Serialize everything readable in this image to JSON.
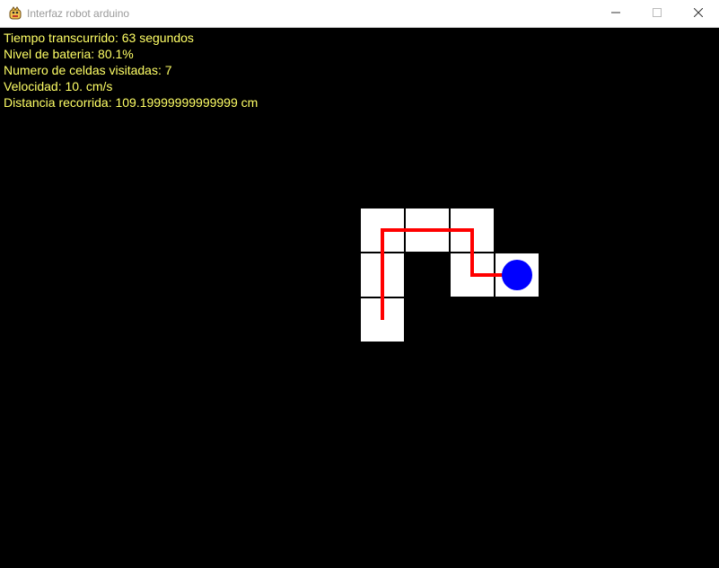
{
  "window": {
    "title": "Interfaz robot arduino",
    "icon": "pygame-snake-icon",
    "controls": [
      "minimize-icon",
      "maximize-icon",
      "close-icon"
    ]
  },
  "stats": {
    "tiempo": "Tiempo transcurrido: 63 segundos",
    "bateria": "Nivel de bateria: 80.1%",
    "celdas": "Numero de celdas visitadas: 7",
    "velocidad": "Velocidad: 10. cm/s",
    "distancia": "Distancia recorrida: 109.19999999999999 cm"
  },
  "grid": {
    "visited_cells": [
      {
        "col": 0,
        "row": 0
      },
      {
        "col": 1,
        "row": 0
      },
      {
        "col": 2,
        "row": 0
      },
      {
        "col": 0,
        "row": 1
      },
      {
        "col": 2,
        "row": 1
      },
      {
        "col": 3,
        "row": 1
      },
      {
        "col": 0,
        "row": 2
      }
    ],
    "path": [
      {
        "col": 0,
        "row": 2
      },
      {
        "col": 0,
        "row": 1
      },
      {
        "col": 0,
        "row": 0
      },
      {
        "col": 1,
        "row": 0
      },
      {
        "col": 2,
        "row": 0
      },
      {
        "col": 2,
        "row": 1
      },
      {
        "col": 3,
        "row": 1
      }
    ],
    "robot": {
      "col": 3,
      "row": 1
    },
    "colors": {
      "cell": "#ffffff",
      "cell_border": "#000000",
      "path": "#ff0000",
      "robot": "#0000ff",
      "text": "#ffff66",
      "background": "#000000"
    }
  }
}
